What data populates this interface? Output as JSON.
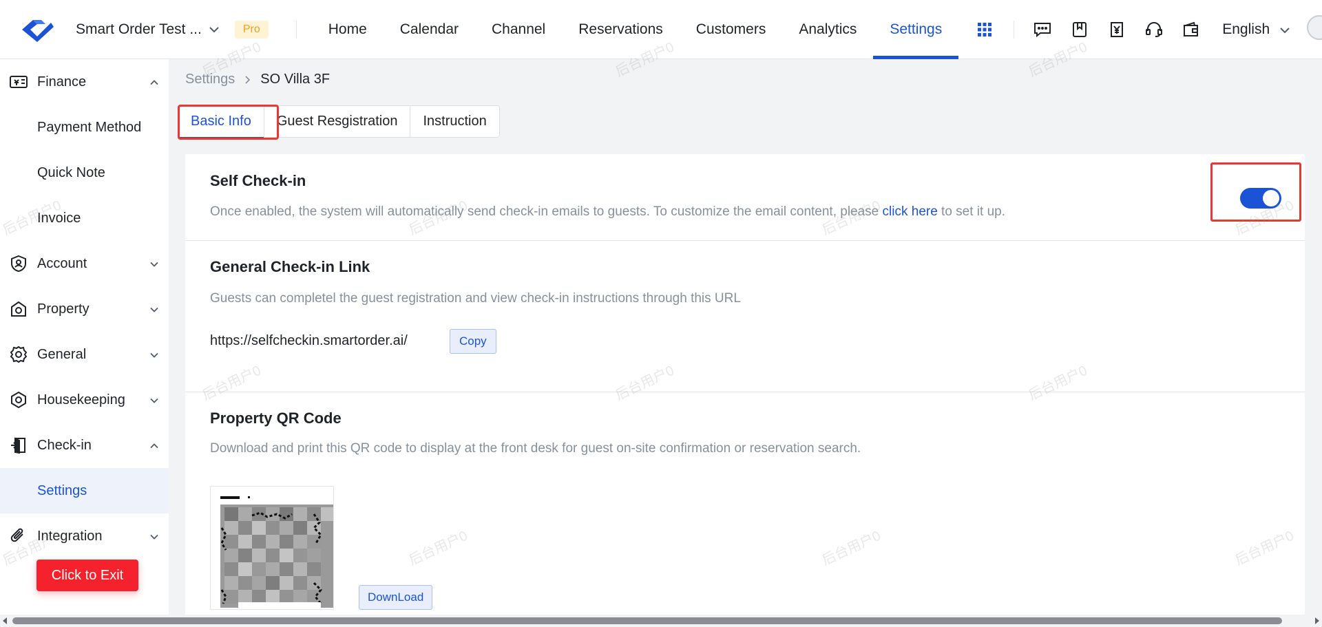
{
  "header": {
    "org_name": "Smart Order Test ...",
    "plan_badge": "Pro",
    "nav": [
      "Home",
      "Calendar",
      "Channel",
      "Reservations",
      "Customers",
      "Analytics",
      "Settings"
    ],
    "active_nav": "Settings",
    "tools": [
      "message-icon",
      "bookmark-icon",
      "yen-receipt-icon",
      "headset-icon",
      "wallet-icon"
    ],
    "language": "English"
  },
  "sidebar": {
    "finance": "Finance",
    "payment_method": "Payment Method",
    "quick_note": "Quick Note",
    "invoice": "Invoice",
    "account": "Account",
    "property": "Property",
    "general": "General",
    "housekeeping": "Housekeeping",
    "checkin": "Check-in",
    "settings": "Settings",
    "integration": "Integration",
    "exit_button": "Click to Exit"
  },
  "breadcrumb": {
    "root": "Settings",
    "current": "SO Villa 3F"
  },
  "tabs": [
    "Basic Info",
    "Guest Resgistration",
    "Instruction"
  ],
  "active_tab": "Basic Info",
  "self_checkin": {
    "title": "Self Check-in",
    "desc_before": "Once enabled, the system will automatically send check-in emails to guests. To customize the email content, please ",
    "link": "click here",
    "desc_after": " to set it up.",
    "enabled": true
  },
  "general_link": {
    "title": "General Check-in Link",
    "desc": "Guests can completel the guest registration and view check-in instructions through this URL",
    "url": "https://selfcheckin.smartorder.ai/",
    "copy_label": "Copy"
  },
  "qr_section": {
    "title": "Property QR Code",
    "desc": "Download and print this QR code to display at the front desk for guest on-site confirmation or reservation search.",
    "download_label": "DownLoad"
  },
  "watermark": "后台用户0",
  "colors": {
    "primary": "#1a53d6",
    "highlight": "#e53935",
    "exit": "#f5222d",
    "pro_badge": "#f0a020"
  }
}
